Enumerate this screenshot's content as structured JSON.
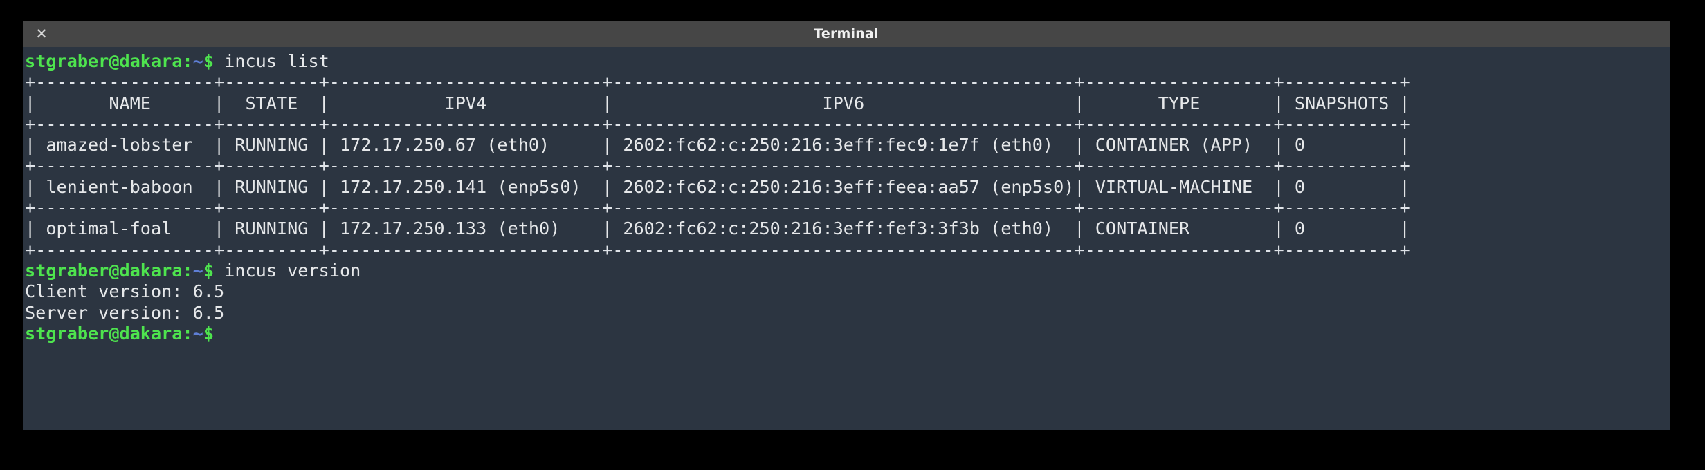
{
  "window": {
    "title": "Terminal",
    "close_icon": "close-icon",
    "close_glyph": "✕",
    "titlebar_color": "#464646",
    "background_color": "#2c3541",
    "foreground_color": "#e6e8ea",
    "prompt_color": "#4ee44e",
    "path_color": "#5f7fd6"
  },
  "terminal": {
    "prompt": {
      "user_host": "stgraber@dakara",
      "separator": ":",
      "path": "~",
      "symbol": "$"
    },
    "commands": {
      "list": "incus list",
      "version": "incus version"
    },
    "table": {
      "rule": "+-----------------+---------+--------------------------+--------------------------------------------+------------------+-----------+",
      "headers": [
        "NAME",
        "STATE",
        "IPV4",
        "IPV6",
        "TYPE",
        "SNAPSHOTS"
      ],
      "header_row": "|       NAME      |  STATE  |           IPV4           |                    IPV6                    |       TYPE       | SNAPSHOTS |",
      "rows": [
        {
          "name": "amazed-lobster",
          "state": "RUNNING",
          "ipv4": "172.17.250.67 (eth0)",
          "ipv6": "2602:fc62:c:250:216:3eff:fec9:1e7f (eth0)",
          "type": "CONTAINER (APP)",
          "snapshots": "0",
          "text": "| amazed-lobster  | RUNNING | 172.17.250.67 (eth0)     | 2602:fc62:c:250:216:3eff:fec9:1e7f (eth0)  | CONTAINER (APP)  | 0         |"
        },
        {
          "name": "lenient-baboon",
          "state": "RUNNING",
          "ipv4": "172.17.250.141 (enp5s0)",
          "ipv6": "2602:fc62:c:250:216:3eff:feea:aa57 (enp5s0)",
          "type": "VIRTUAL-MACHINE",
          "snapshots": "0",
          "text": "| lenient-baboon  | RUNNING | 172.17.250.141 (enp5s0)  | 2602:fc62:c:250:216:3eff:feea:aa57 (enp5s0)| VIRTUAL-MACHINE  | 0         |"
        },
        {
          "name": "optimal-foal",
          "state": "RUNNING",
          "ipv4": "172.17.250.133 (eth0)",
          "ipv6": "2602:fc62:c:250:216:3eff:fef3:3f3b (eth0)",
          "type": "CONTAINER",
          "snapshots": "0",
          "text": "| optimal-foal    | RUNNING | 172.17.250.133 (eth0)    | 2602:fc62:c:250:216:3eff:fef3:3f3b (eth0)  | CONTAINER        | 0         |"
        }
      ]
    },
    "version_output": {
      "client": "Client version: 6.5",
      "server": "Server version: 6.5"
    }
  }
}
